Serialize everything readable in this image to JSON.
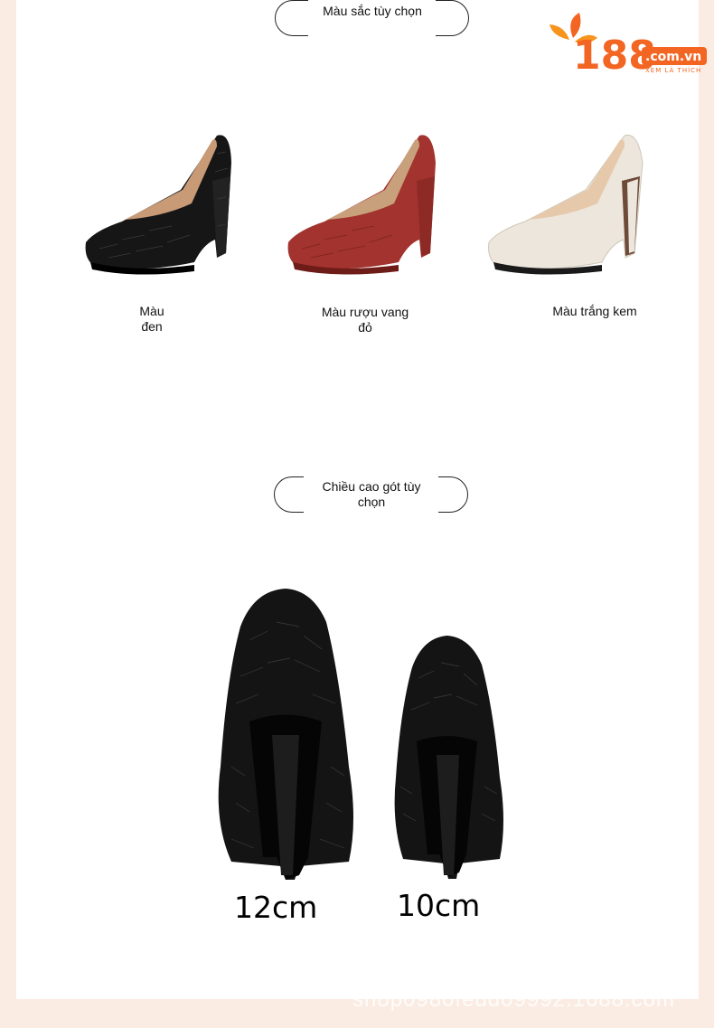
{
  "logo": {
    "number": "188",
    "domain": ".com.vn",
    "tagline": "XEM LÀ THÍCH"
  },
  "color_section": {
    "title": "Màu sắc tùy chọn",
    "options": [
      {
        "label": "Màu đen"
      },
      {
        "label": "Màu rượu vang đỏ"
      },
      {
        "label": "Màu trắng kem"
      }
    ]
  },
  "heel_section": {
    "title": "Chiều cao gót tùy chọn",
    "options": [
      {
        "label": "12cm"
      },
      {
        "label": "10cm"
      }
    ]
  },
  "watermark": "shop0980fedd09992.1688.com",
  "colors": {
    "black": "#1a1a1a",
    "wine_red": "#a2332e",
    "cream": "#ece6dc",
    "brand_orange": "#f26522"
  }
}
